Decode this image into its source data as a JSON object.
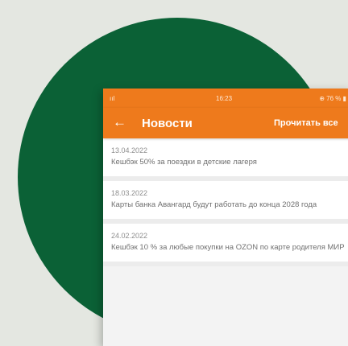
{
  "status_bar": {
    "signal": "ııl",
    "time": "16:23",
    "battery": "⊕ 76 % ▮"
  },
  "header": {
    "back_icon": "←",
    "title": "Новости",
    "read_all": "Прочитать все"
  },
  "news": [
    {
      "date": "13.04.2022",
      "text": "Кешбэк 50% за поездки в детские лагеря"
    },
    {
      "date": "18.03.2022",
      "text": "Карты банка Авангард будут работать до конца 2028 года"
    },
    {
      "date": "24.02.2022",
      "text": "Кешбэк 10 % за любые покупки на OZON по карте родителя МИР"
    }
  ],
  "colors": {
    "background": "#e4e7e1",
    "circle": "#0b6136",
    "accent": "#ee7a1c"
  }
}
